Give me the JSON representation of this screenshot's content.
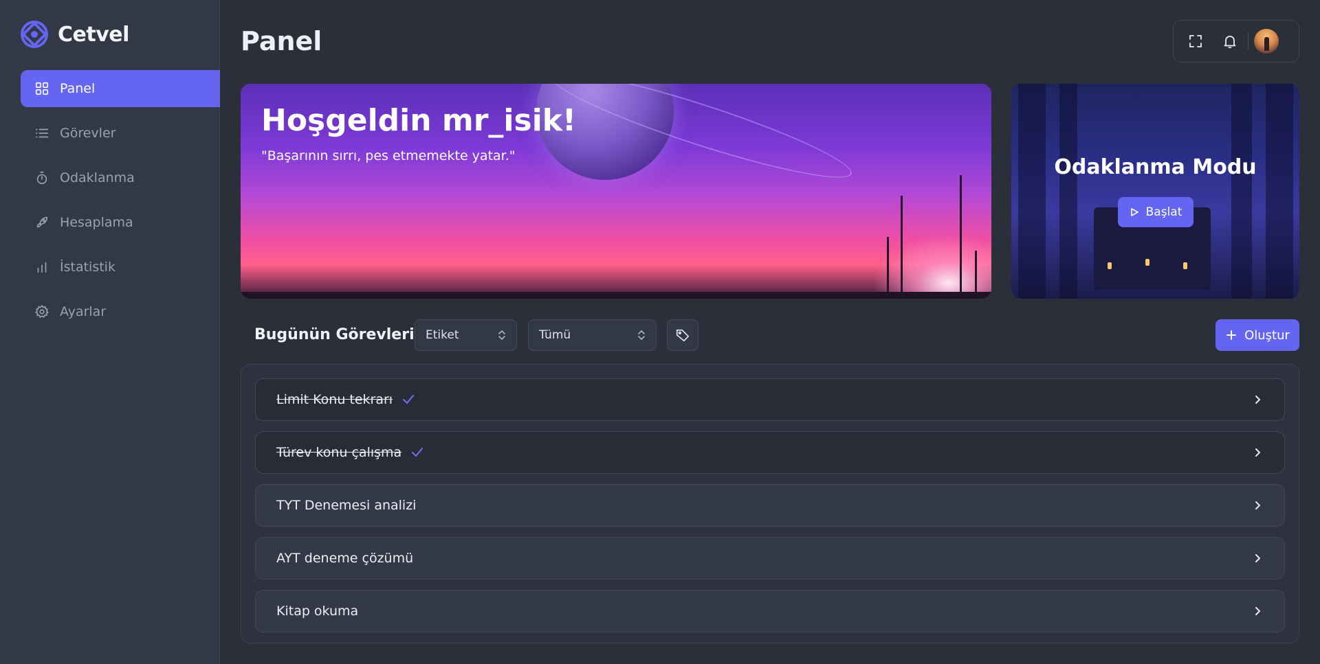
{
  "app": {
    "name": "Cetvel"
  },
  "sidebar": {
    "items": [
      {
        "label": "Panel",
        "icon": "grid-icon",
        "active": true
      },
      {
        "label": "Görevler",
        "icon": "list-icon",
        "active": false
      },
      {
        "label": "Odaklanma",
        "icon": "stopwatch-icon",
        "active": false
      },
      {
        "label": "Hesaplama",
        "icon": "rocket-icon",
        "active": false
      },
      {
        "label": "İstatistik",
        "icon": "bar-chart-icon",
        "active": false
      },
      {
        "label": "Ayarlar",
        "icon": "gear-icon",
        "active": false
      }
    ]
  },
  "header": {
    "title": "Panel",
    "tools": [
      "fullscreen-icon",
      "bell-icon",
      "avatar"
    ]
  },
  "hero": {
    "title": "Hoşgeldin mr_isik!",
    "quote": "\"Başarının sırrı, pes etmemekte yatar.\""
  },
  "focus": {
    "title": "Odaklanma Modu",
    "start_label": "Başlat"
  },
  "tasks": {
    "title": "Bugünün Görevleri",
    "filter_tag": "Etiket",
    "filter_status": "Tümü",
    "create_label": "Oluştur",
    "items": [
      {
        "label": "Limit Konu tekrarı",
        "done": true
      },
      {
        "label": "Türev konu çalışma",
        "done": true
      },
      {
        "label": "TYT Denemesi analizi",
        "done": false
      },
      {
        "label": "AYT deneme çözümü",
        "done": false
      },
      {
        "label": "Kitap okuma",
        "done": false
      }
    ]
  },
  "colors": {
    "accent": "#6466f1",
    "background": "#2a2f3a",
    "sidebar": "#323845"
  }
}
